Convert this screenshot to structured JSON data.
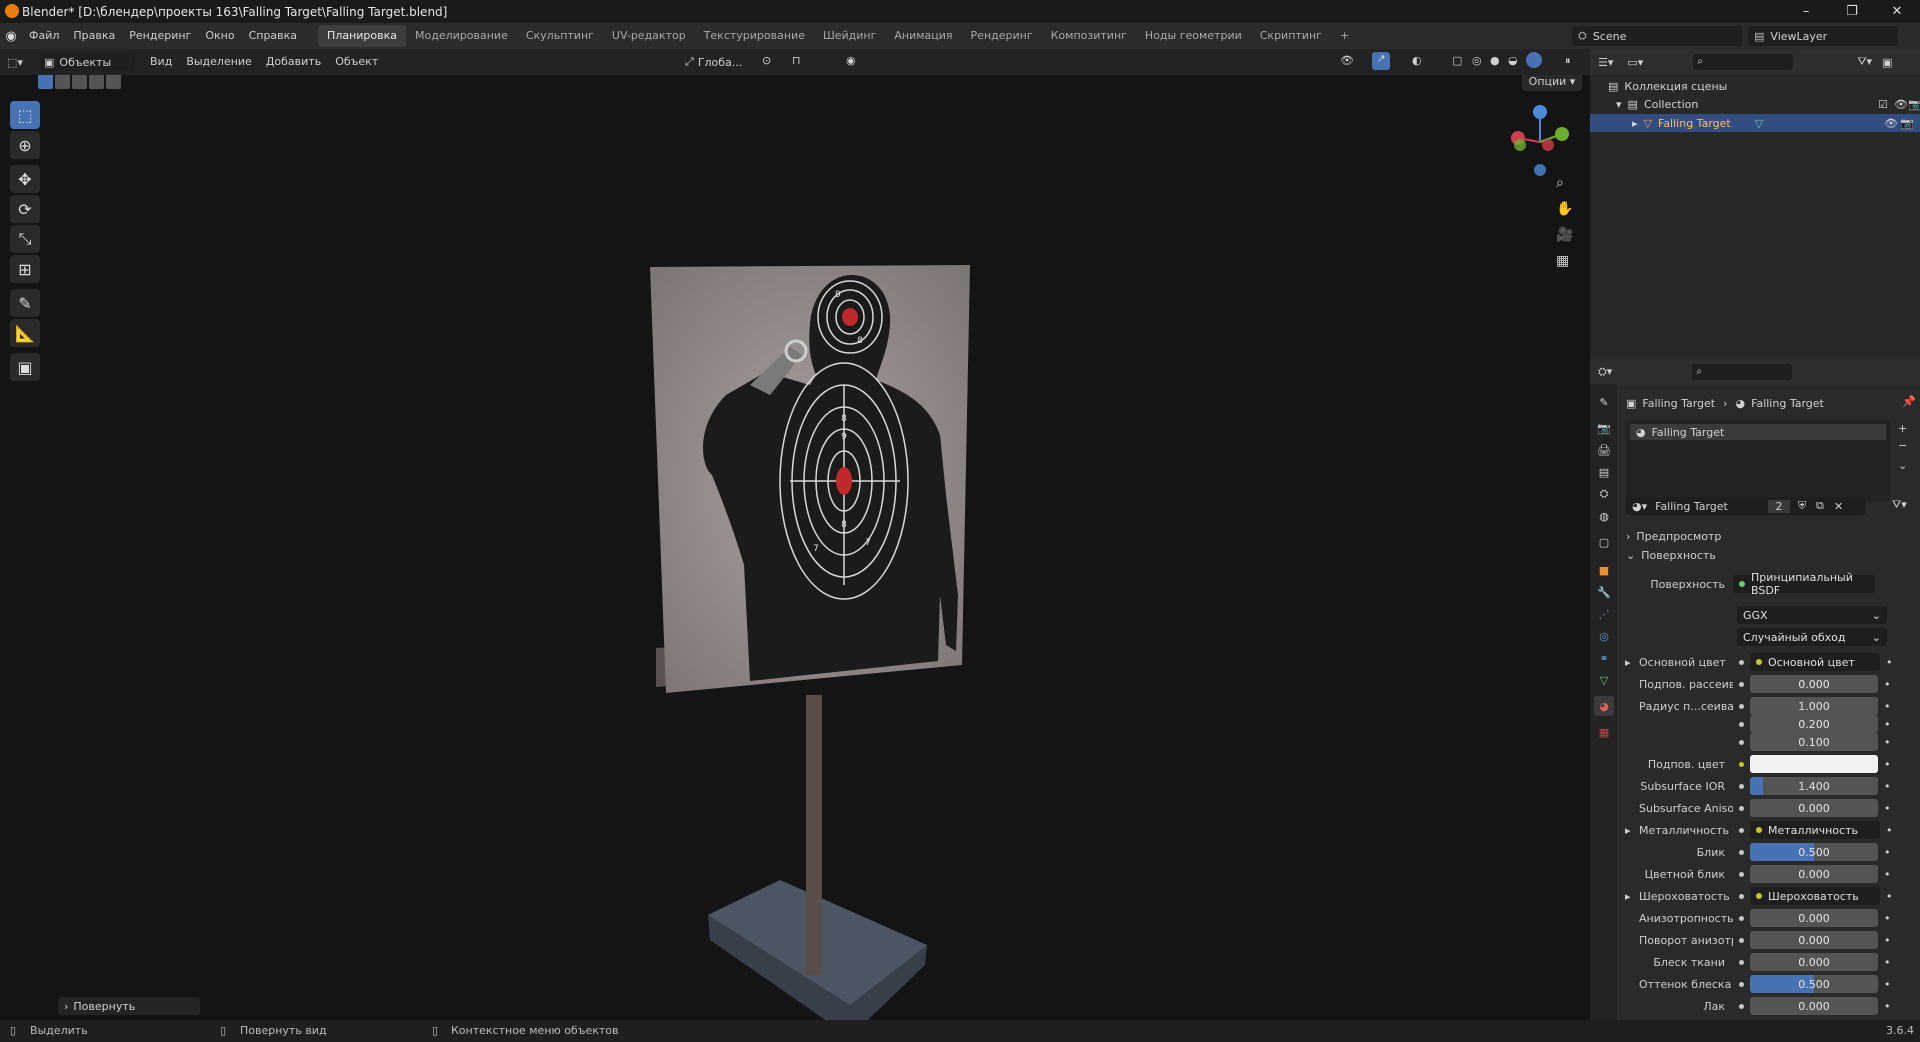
{
  "window": {
    "title": "Blender* [D:\\блендер\\проекты 163\\Falling Target\\Falling Target.blend]",
    "controls": [
      "–",
      "❐",
      "✕"
    ]
  },
  "menu": [
    "Файл",
    "Правка",
    "Рендеринг",
    "Окно",
    "Справка"
  ],
  "workspaces": [
    "Планировка",
    "Моделирование",
    "Скульптинг",
    "UV-редактор",
    "Текстурирование",
    "Шейдинг",
    "Анимация",
    "Рендеринг",
    "Композитинг",
    "Ноды геометрии",
    "Скриптинг",
    "+"
  ],
  "active_workspace": "Планировка",
  "scene": {
    "label": "Scene",
    "view_layer": "ViewLayer"
  },
  "viewport_header": {
    "mode": "Объекты",
    "menus": [
      "Вид",
      "Выделение",
      "Добавить",
      "Объект"
    ],
    "transform": "Глоба...",
    "options": "Опции"
  },
  "last_operator": "Повернуть",
  "outliner": {
    "root": "Коллекция сцены",
    "collection": "Collection",
    "object": "Falling Target"
  },
  "properties": {
    "breadcrumb": [
      "Falling Target",
      "Falling Target"
    ],
    "slot": "Falling Target",
    "material_name": "Falling Target",
    "users": "2",
    "panels": {
      "preview": "Предпросмотр",
      "surface": "Поверхность"
    },
    "surface_label": "Поверхность",
    "surface_shader": "Принципиальный BSDF",
    "distribution": "GGX",
    "subsurface_method": "Случайный обход",
    "fields": [
      {
        "label": "Основной цвет",
        "link": "Основной цвет",
        "expand": true
      },
      {
        "label": "Подпов. рассеива...",
        "value": "0.000"
      },
      {
        "label": "Радиус п...сеивания",
        "value": "1.000"
      },
      {
        "label": "",
        "value": "0.200"
      },
      {
        "label": "",
        "value": "0.100"
      },
      {
        "label": "Подпов. цвет",
        "color": "#f2f2f2"
      },
      {
        "label": "Subsurface IOR",
        "value": "1.400",
        "fill": 0.1
      },
      {
        "label": "Subsurface Anisotr...",
        "value": "0.000"
      },
      {
        "label": "Металличность",
        "link": "Металличность",
        "expand": true
      },
      {
        "label": "Блик",
        "value": "0.500",
        "fill": 0.5
      },
      {
        "label": "Цветной блик",
        "value": "0.000"
      },
      {
        "label": "Шероховатость",
        "link": "Шероховатость",
        "expand": true
      },
      {
        "label": "Анизотропность",
        "value": "0.000"
      },
      {
        "label": "Поворот анизотро...",
        "value": "0.000"
      },
      {
        "label": "Блеск ткани",
        "value": "0.000"
      },
      {
        "label": "Оттенок блеска тк...",
        "value": "0.500",
        "fill": 0.5
      },
      {
        "label": "Лак",
        "value": "0.000"
      }
    ]
  },
  "statusbar": {
    "select": "Выделить",
    "rotate_view": "Повернуть вид",
    "context_menu": "Контекстное меню объектов",
    "version": "3.6.4"
  },
  "target": {
    "ring_numbers": [
      "10",
      "9",
      "8",
      "7",
      "6",
      "5"
    ]
  }
}
